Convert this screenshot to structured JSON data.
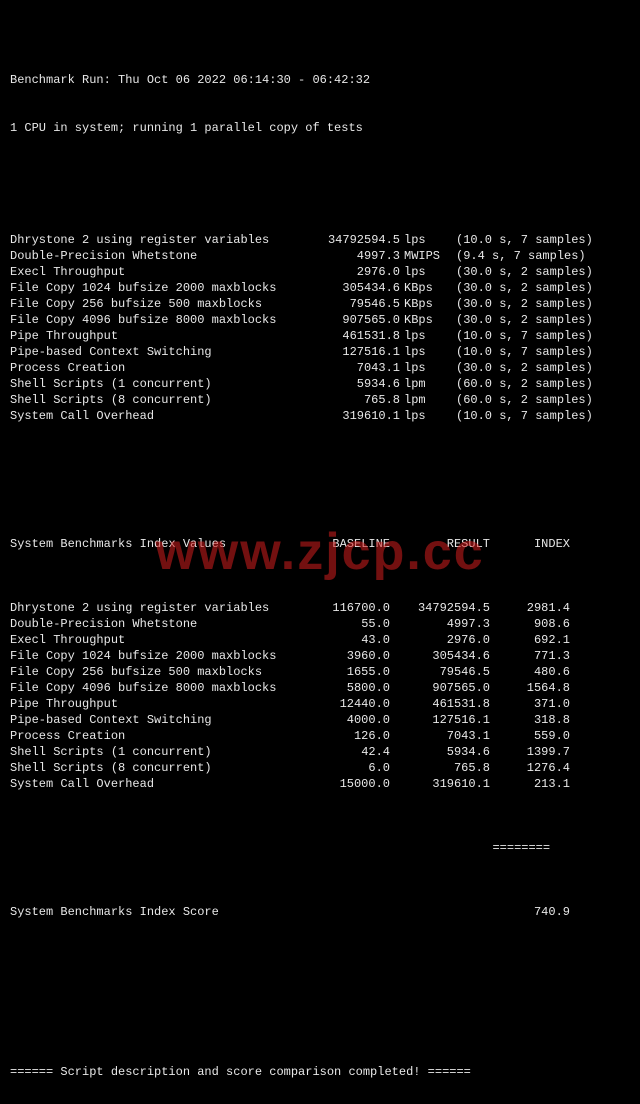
{
  "header": {
    "run": "Benchmark Run: Thu Oct 06 2022 06:14:30 - 06:42:32",
    "cpu": "1 CPU in system; running 1 parallel copy of tests"
  },
  "tests": [
    {
      "name": "Dhrystone 2 using register variables",
      "value": "34792594.5",
      "unit": "lps",
      "dur": "(10.0 s, 7 samples)"
    },
    {
      "name": "Double-Precision Whetstone",
      "value": "4997.3",
      "unit": "MWIPS",
      "dur": "(9.4 s, 7 samples)"
    },
    {
      "name": "Execl Throughput",
      "value": "2976.0",
      "unit": "lps",
      "dur": "(30.0 s, 2 samples)"
    },
    {
      "name": "File Copy 1024 bufsize 2000 maxblocks",
      "value": "305434.6",
      "unit": "KBps",
      "dur": "(30.0 s, 2 samples)"
    },
    {
      "name": "File Copy 256 bufsize 500 maxblocks",
      "value": "79546.5",
      "unit": "KBps",
      "dur": "(30.0 s, 2 samples)"
    },
    {
      "name": "File Copy 4096 bufsize 8000 maxblocks",
      "value": "907565.0",
      "unit": "KBps",
      "dur": "(30.0 s, 2 samples)"
    },
    {
      "name": "Pipe Throughput",
      "value": "461531.8",
      "unit": "lps",
      "dur": "(10.0 s, 7 samples)"
    },
    {
      "name": "Pipe-based Context Switching",
      "value": "127516.1",
      "unit": "lps",
      "dur": "(10.0 s, 7 samples)"
    },
    {
      "name": "Process Creation",
      "value": "7043.1",
      "unit": "lps",
      "dur": "(30.0 s, 2 samples)"
    },
    {
      "name": "Shell Scripts (1 concurrent)",
      "value": "5934.6",
      "unit": "lpm",
      "dur": "(60.0 s, 2 samples)"
    },
    {
      "name": "Shell Scripts (8 concurrent)",
      "value": "765.8",
      "unit": "lpm",
      "dur": "(60.0 s, 2 samples)"
    },
    {
      "name": "System Call Overhead",
      "value": "319610.1",
      "unit": "lps",
      "dur": "(10.0 s, 7 samples)"
    }
  ],
  "index_header": {
    "title": "System Benchmarks Index Values",
    "c1": "BASELINE",
    "c2": "RESULT",
    "c3": "INDEX"
  },
  "index": [
    {
      "name": "Dhrystone 2 using register variables",
      "baseline": "116700.0",
      "result": "34792594.5",
      "index": "2981.4"
    },
    {
      "name": "Double-Precision Whetstone",
      "baseline": "55.0",
      "result": "4997.3",
      "index": "908.6"
    },
    {
      "name": "Execl Throughput",
      "baseline": "43.0",
      "result": "2976.0",
      "index": "692.1"
    },
    {
      "name": "File Copy 1024 bufsize 2000 maxblocks",
      "baseline": "3960.0",
      "result": "305434.6",
      "index": "771.3"
    },
    {
      "name": "File Copy 256 bufsize 500 maxblocks",
      "baseline": "1655.0",
      "result": "79546.5",
      "index": "480.6"
    },
    {
      "name": "File Copy 4096 bufsize 8000 maxblocks",
      "baseline": "5800.0",
      "result": "907565.0",
      "index": "1564.8"
    },
    {
      "name": "Pipe Throughput",
      "baseline": "12440.0",
      "result": "461531.8",
      "index": "371.0"
    },
    {
      "name": "Pipe-based Context Switching",
      "baseline": "4000.0",
      "result": "127516.1",
      "index": "318.8"
    },
    {
      "name": "Process Creation",
      "baseline": "126.0",
      "result": "7043.1",
      "index": "559.0"
    },
    {
      "name": "Shell Scripts (1 concurrent)",
      "baseline": "42.4",
      "result": "5934.6",
      "index": "1399.7"
    },
    {
      "name": "Shell Scripts (8 concurrent)",
      "baseline": "6.0",
      "result": "765.8",
      "index": "1276.4"
    },
    {
      "name": "System Call Overhead",
      "baseline": "15000.0",
      "result": "319610.1",
      "index": "213.1"
    }
  ],
  "rule": "                                                                   ========",
  "score_label": "System Benchmarks Index Score",
  "score_value": "740.9",
  "footer": "====== Script description and score comparison completed! ======",
  "watermark": "www.zjcp.cc"
}
